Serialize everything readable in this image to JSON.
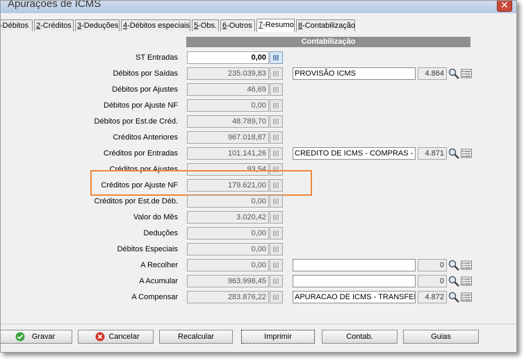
{
  "window": {
    "title": "Apurações de ICMS",
    "close_glyph": "✕"
  },
  "tabs": [
    {
      "key": "",
      "rest": "-Débitos"
    },
    {
      "key": "2",
      "rest": "-Créditos"
    },
    {
      "key": "3",
      "rest": "-Deduções"
    },
    {
      "key": "4",
      "rest": "-Débitos especiais"
    },
    {
      "key": "5",
      "rest": "-Obs."
    },
    {
      "key": "6",
      "rest": "-Outros"
    },
    {
      "key": "7",
      "rest": "-Resumo"
    },
    {
      "key": "8",
      "rest": "-Contabilização"
    }
  ],
  "active_tab": "7-Resumo",
  "section": {
    "contab_header": "Contabilização"
  },
  "rows": [
    {
      "label": "ST Entradas",
      "value": "0,00"
    },
    {
      "label": "Débitos por Saídas",
      "value": "235.039,83",
      "account": "PROVISÃO ICMS",
      "code": "4.864"
    },
    {
      "label": "Débitos por Ajustes",
      "value": "46,69"
    },
    {
      "label": "Débitos por Ajuste NF",
      "value": "0,00"
    },
    {
      "label": "Débitos por Est.de Créd.",
      "value": "48.789,70"
    },
    {
      "label": "Créditos Anteriores",
      "value": "967.018,87"
    },
    {
      "label": "Créditos por Entradas",
      "value": "101.141,26",
      "account": "CREDITO DE ICMS - COMPRAS -",
      "code": "4.871"
    },
    {
      "label": "Créditos por Ajustes",
      "value": "93,54"
    },
    {
      "label": "Créditos por Ajuste NF",
      "value": "179.621,00"
    },
    {
      "label": "Créditos por Est.de Déb.",
      "value": "0,00"
    },
    {
      "label": "Valor do Mês",
      "value": "3.020,42"
    },
    {
      "label": "Deduções",
      "value": "0,00"
    },
    {
      "label": "Débitos Especiais",
      "value": "0,00"
    },
    {
      "label": "A Recolher",
      "value": "0,00",
      "account": "",
      "code": "0"
    },
    {
      "label": "A Acumular",
      "value": "963.998,45",
      "account": "",
      "code": "0"
    },
    {
      "label": "A Compensar",
      "value": "283.876,22",
      "account": "APURACAO DE ICMS - TRANSFEREN",
      "code": "4.872"
    }
  ],
  "buttons": {
    "gravar": "Gravar",
    "cancelar": "Cancelar",
    "recalcular": "Recalcular",
    "imprimir": "Imprimir",
    "contab": "Contab.",
    "guias": "Guias"
  },
  "colors": {
    "highlight": "#f0863c",
    "header_bg": "#8f8f8f",
    "ok_green": "#3aa63a",
    "cancel_red": "#d03a2a"
  }
}
